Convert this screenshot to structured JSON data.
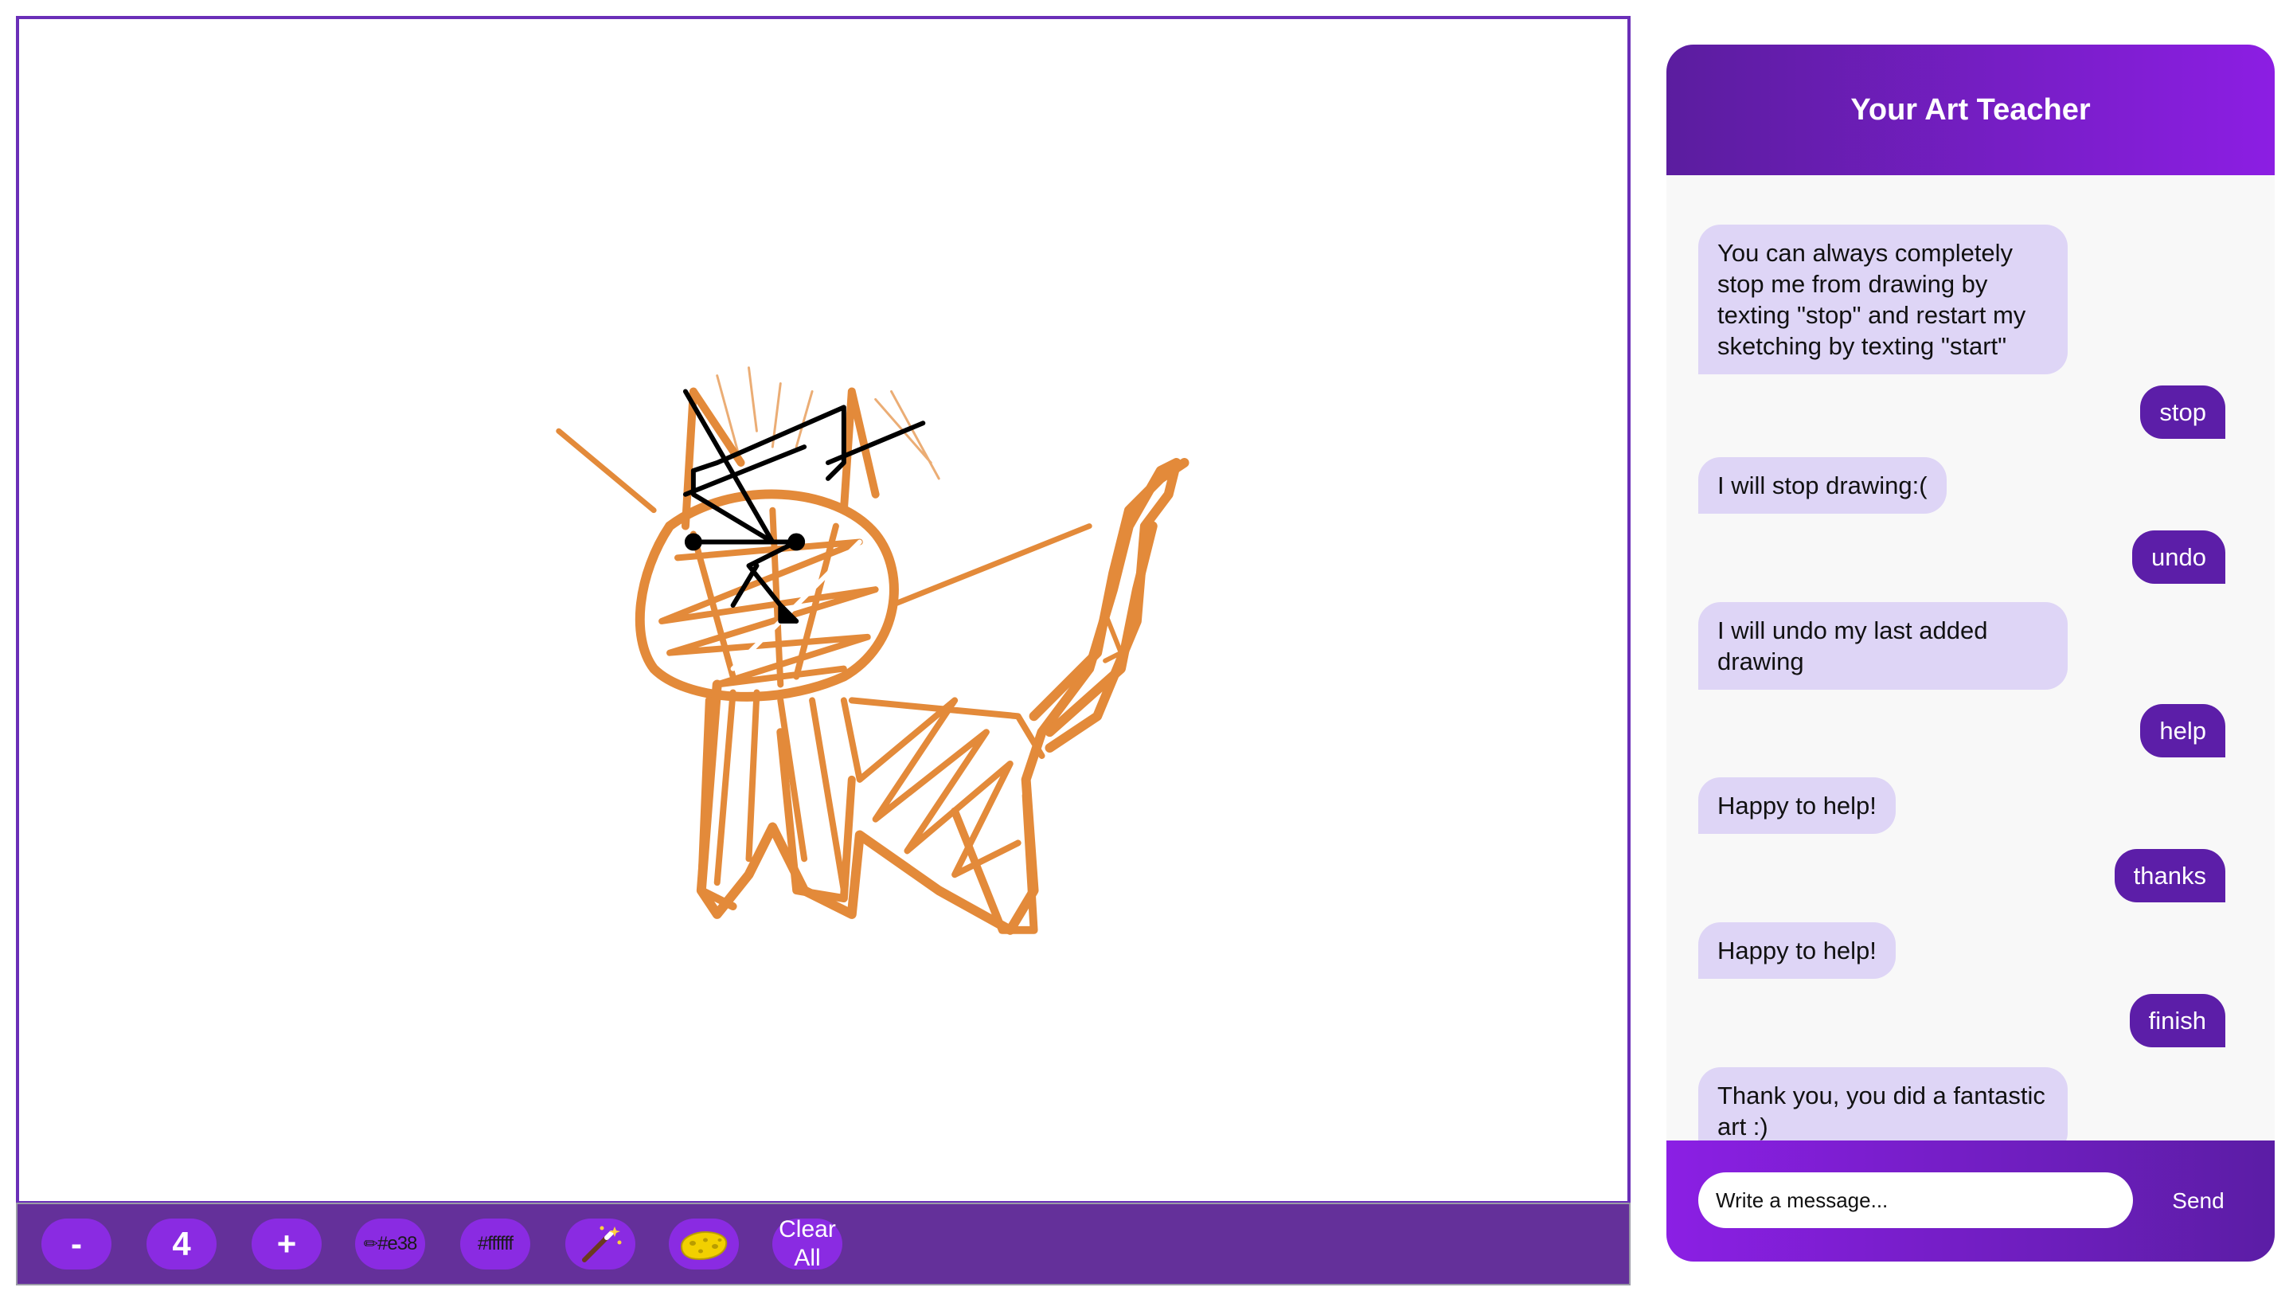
{
  "toolbar": {
    "decrease_label": "-",
    "brush_size": "4",
    "increase_label": "+",
    "stroke_color_label": "#e38",
    "fill_color_label": "#ffffff",
    "magic_icon": "magic-wand-icon",
    "eraser_icon": "sponge-icon",
    "clear_all_line1": "Clear",
    "clear_all_line2": "All"
  },
  "colors": {
    "accent": "#8a2be2",
    "toolbar_bg": "#64309a",
    "bot_bubble": "#ded5f6",
    "user_bubble": "#5c1ea8",
    "drawing_orange": "#e38a3a"
  },
  "chat": {
    "title": "Your Art Teacher",
    "messages": [
      {
        "from": "bot",
        "text": "You can always completely stop me from drawing by texting \"stop\" and restart my sketching by texting \"start\""
      },
      {
        "from": "user",
        "text": "stop"
      },
      {
        "from": "bot",
        "text": "I will stop drawing:("
      },
      {
        "from": "user",
        "text": "undo"
      },
      {
        "from": "bot",
        "text": "I will undo my last added drawing"
      },
      {
        "from": "user",
        "text": "help"
      },
      {
        "from": "bot",
        "text": "Happy to help!"
      },
      {
        "from": "user",
        "text": "thanks"
      },
      {
        "from": "bot",
        "text": "Happy to help!"
      },
      {
        "from": "user",
        "text": "finish"
      },
      {
        "from": "bot",
        "text": "Thank you, you did a fantastic art :)"
      }
    ],
    "input_placeholder": "Write a message...",
    "send_label": "Send"
  }
}
